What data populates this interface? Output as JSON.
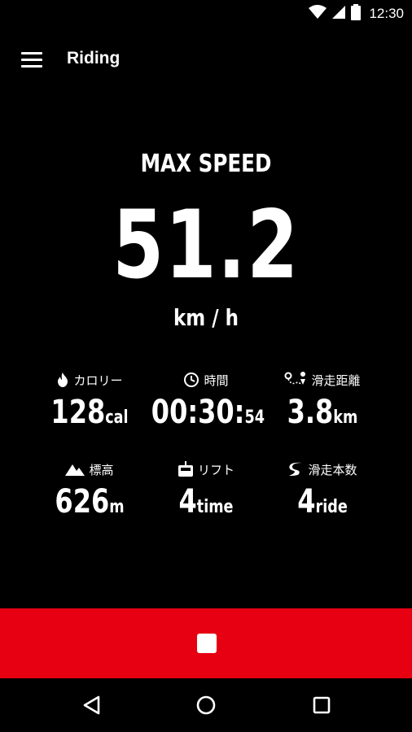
{
  "status_bar": {
    "time": "12:30"
  },
  "app_bar": {
    "title": "Riding"
  },
  "max_speed": {
    "label": "MAX SPEED",
    "value": "51.2",
    "unit": "km / h"
  },
  "stats": [
    {
      "id": "calories",
      "icon": "flame-icon",
      "label": "カロリー",
      "value": "128",
      "unit": "cal"
    },
    {
      "id": "time",
      "icon": "clock-icon",
      "label": "時間",
      "value": "00:30:",
      "unit": "54"
    },
    {
      "id": "distance",
      "icon": "route-icon",
      "label": "滑走距離",
      "value": "3.8",
      "unit": "km"
    },
    {
      "id": "altitude",
      "icon": "mountain-icon",
      "label": "標高",
      "value": "626",
      "unit": "m"
    },
    {
      "id": "lift",
      "icon": "lift-icon",
      "label": "リフト",
      "value": "4",
      "unit": "time"
    },
    {
      "id": "runs",
      "icon": "ski-run-icon",
      "label": "滑走本数",
      "value": "4",
      "unit": "ride"
    }
  ],
  "colors": {
    "accent": "#e60012",
    "background": "#000000",
    "text": "#ffffff"
  },
  "stop_button": {
    "icon": "stop-icon"
  },
  "nav": {
    "back_icon": "back-icon",
    "home_icon": "home-icon",
    "recents_icon": "recents-icon"
  }
}
